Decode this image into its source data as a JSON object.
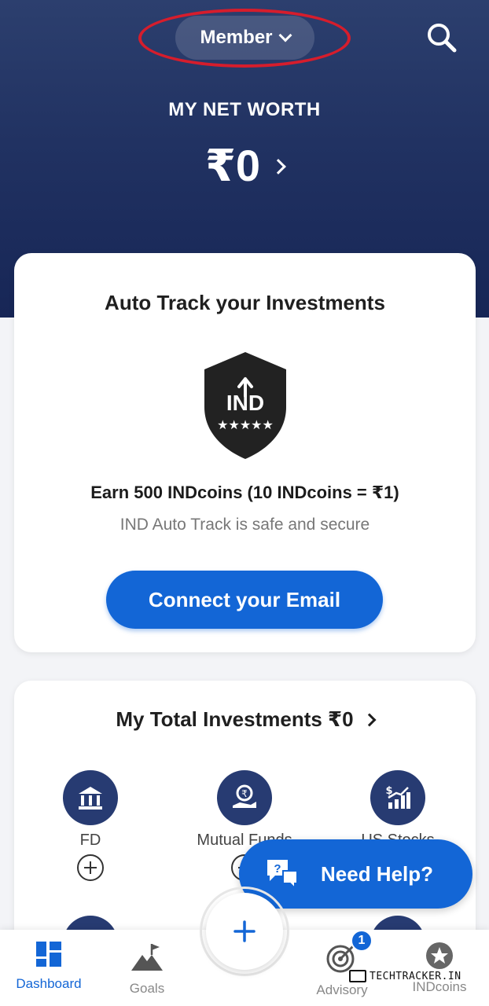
{
  "header": {
    "member_label": "Member",
    "net_worth_label": "MY NET WORTH",
    "net_worth_value": "₹0"
  },
  "auto_track_card": {
    "title": "Auto Track your Investments",
    "logo_text": "IND",
    "earn_text": "Earn 500 INDcoins (10 INDcoins = ₹1)",
    "safe_text": "IND Auto Track is safe and secure",
    "connect_button": "Connect your Email"
  },
  "investments_card": {
    "title": "My Total Investments ₹0",
    "items": [
      {
        "label": "FD",
        "icon": "bank-icon"
      },
      {
        "label": "Mutual Funds",
        "icon": "rupee-hand-icon"
      },
      {
        "label": "US Stocks",
        "icon": "stocks-chart-icon"
      }
    ]
  },
  "help_button": {
    "label": "Need Help?"
  },
  "tabbar": {
    "tabs": [
      {
        "label": "Dashboard",
        "active": true
      },
      {
        "label": "Goals",
        "active": false
      },
      {
        "label": "Advisory",
        "active": false,
        "badge": "1"
      },
      {
        "label": "INDcoins",
        "active": false
      }
    ]
  },
  "watermark": "TECHTRACKER.IN",
  "colors": {
    "header_top": "#2c3f6e",
    "header_bottom": "#172656",
    "accent": "#1366d6",
    "icon_circle": "#273b72",
    "highlight_ring": "#d61d2c"
  }
}
